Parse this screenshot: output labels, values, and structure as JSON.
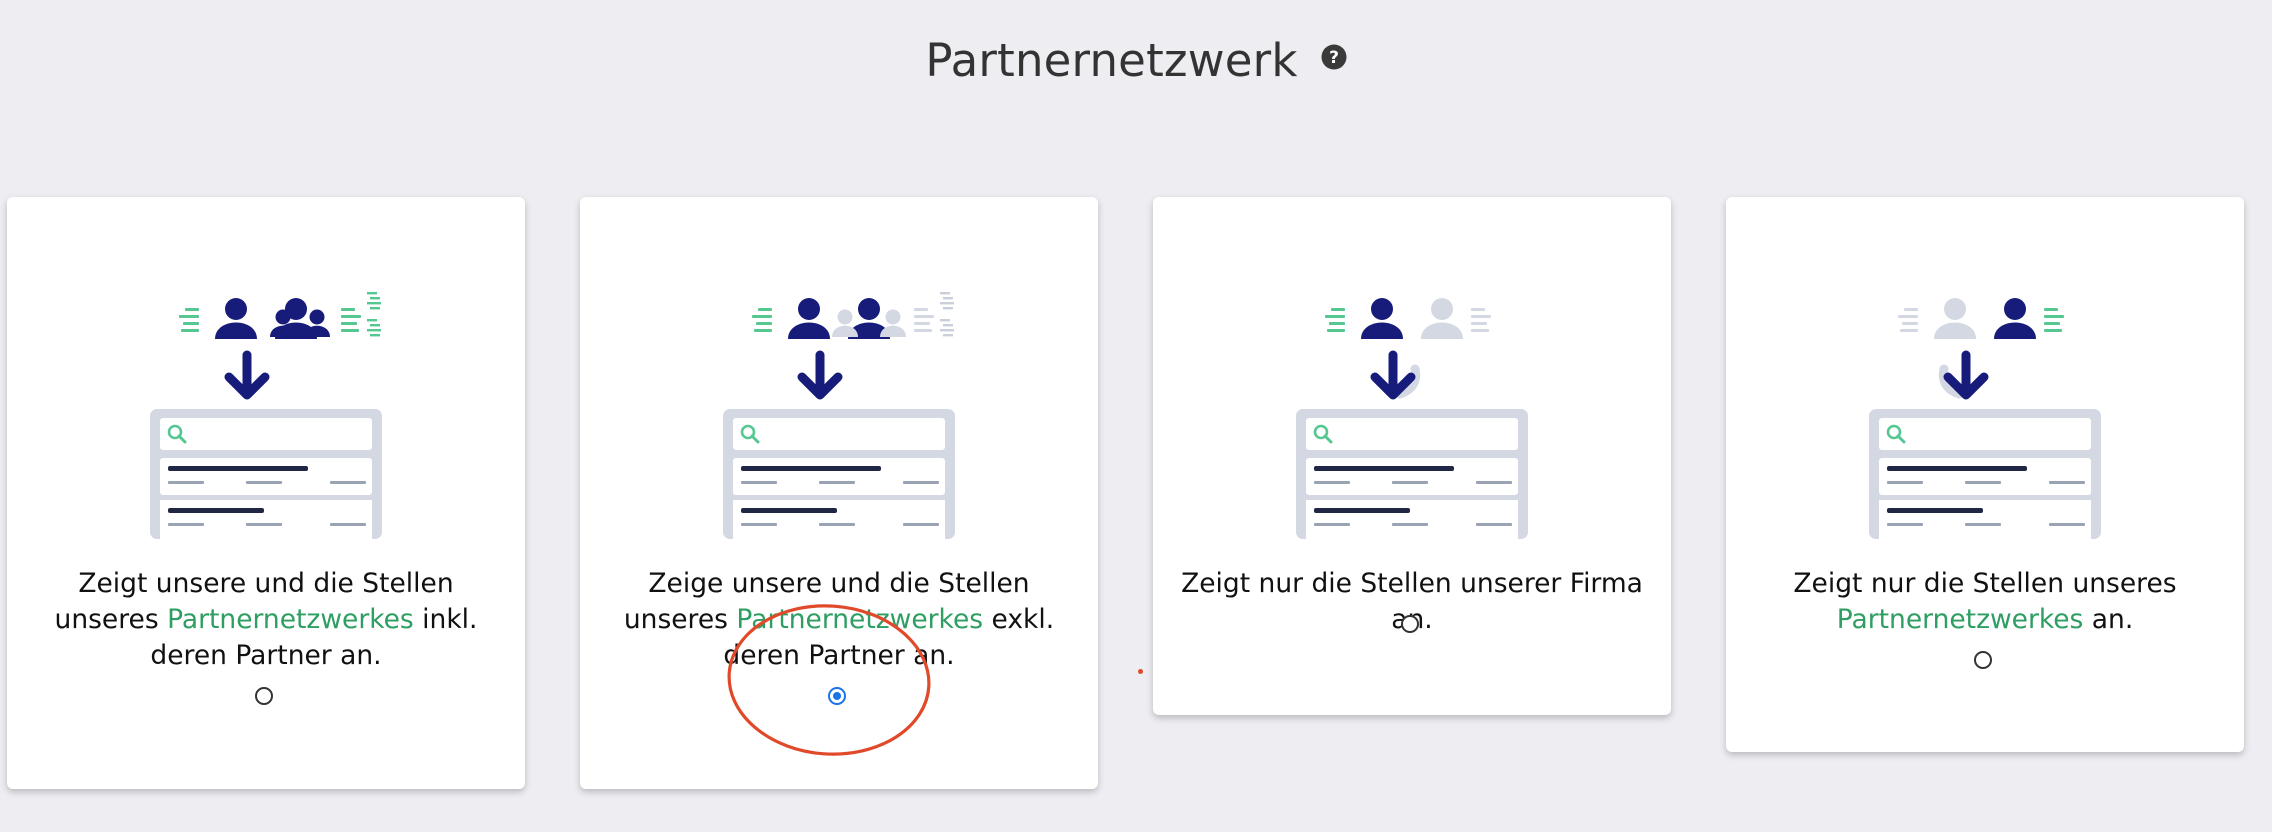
{
  "page": {
    "title": "Partnernetzwerk"
  },
  "colors": {
    "accent": "#1a73e8",
    "link": "#2e9e62",
    "navy": "#171c7a",
    "annotation": "#e04a2a"
  },
  "cards": [
    {
      "desc_pre": "Zeigt unsere und die Stellen unseres ",
      "link": "Partnernetzwerkes",
      "desc_post": " inkl. deren Partner an.",
      "selected": false
    },
    {
      "desc_pre": "Zeige unsere und die Stellen unseres ",
      "link": "Partnernetzwerkes",
      "desc_post": " exkl. deren Partner an.",
      "selected": true
    },
    {
      "desc_pre": "Zeigt nur die Stellen unserer Firma an.",
      "link": "",
      "desc_post": "",
      "selected": false
    },
    {
      "desc_pre": "Zeigt nur die Stellen unseres ",
      "link": "Partnernetzwerkes",
      "desc_post": " an.",
      "selected": false
    }
  ]
}
